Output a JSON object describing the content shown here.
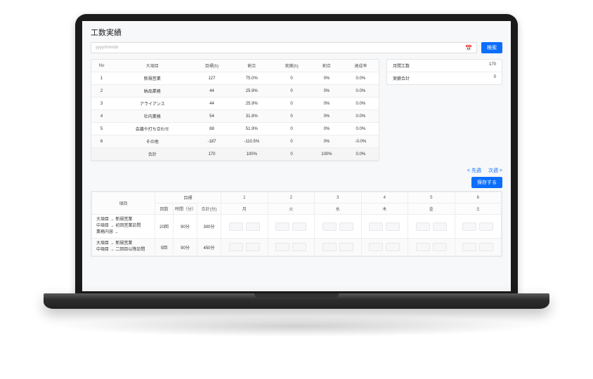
{
  "page": {
    "title": "工数実績"
  },
  "search": {
    "placeholder": "yyyy/mm/dd",
    "cal_icon": "📅",
    "button": "検索"
  },
  "summary_table": {
    "head": {
      "no": "No",
      "item": "大項目",
      "target": "目標(h)",
      "ratio1": "割合",
      "actual": "実績(h)",
      "ratio2": "割合",
      "rate": "達成率"
    },
    "rows": [
      {
        "no": "1",
        "item": "新規営業",
        "target": "127",
        "ratio1": "75.0%",
        "actual": "0",
        "ratio2": "0%",
        "rate": "0.0%"
      },
      {
        "no": "2",
        "item": "納品業務",
        "target": "44",
        "ratio1": "25.9%",
        "actual": "0",
        "ratio2": "0%",
        "rate": "0.0%"
      },
      {
        "no": "3",
        "item": "アライアンス",
        "target": "44",
        "ratio1": "25.9%",
        "actual": "0",
        "ratio2": "0%",
        "rate": "0.0%"
      },
      {
        "no": "4",
        "item": "社内業務",
        "target": "54",
        "ratio1": "31.8%",
        "actual": "0",
        "ratio2": "0%",
        "rate": "0.0%"
      },
      {
        "no": "5",
        "item": "会議や打ち合わせ",
        "target": "88",
        "ratio1": "51.9%",
        "actual": "0",
        "ratio2": "0%",
        "rate": "0.0%"
      },
      {
        "no": "6",
        "item": "その他",
        "target": "-187",
        "ratio1": "-110.5%",
        "actual": "0",
        "ratio2": "0%",
        "rate": "-0.0%"
      }
    ],
    "total": {
      "label": "合計",
      "target": "170",
      "ratio1": "100%",
      "actual": "0",
      "ratio2": "100%",
      "rate": "0.0%"
    }
  },
  "side_summary": {
    "rows": [
      {
        "label": "月間工数",
        "value": "170"
      },
      {
        "label": "実績合計",
        "value": "0"
      }
    ]
  },
  "nav": {
    "prev": "< 先週",
    "next": "次週 >",
    "save": "保存する"
  },
  "detail_table": {
    "head_groups": {
      "item": "項目",
      "target": "目標",
      "d1": "1",
      "d2": "2",
      "d3": "3",
      "d4": "4",
      "d5": "5",
      "d6": "6"
    },
    "head_sub": {
      "count": "回数",
      "time": "時間（分）",
      "total": "合計(分)",
      "wd1": "月",
      "wd2": "火",
      "wd3": "水",
      "wd4": "木",
      "wd5": "金",
      "wd6": "土"
    },
    "rows": [
      {
        "item_l1": "大項目 → 新規営業",
        "item_l2": "中項目 → 初回営業訪問",
        "item_l3": "業務内容 →",
        "count": "20回",
        "time": "90分",
        "total": "300分"
      },
      {
        "item_l1": "大項目 → 新規営業",
        "item_l2": "中項目 → 二回目以降訪問",
        "item_l3": "",
        "count": "5回",
        "time": "90分",
        "total": "450分"
      }
    ]
  }
}
